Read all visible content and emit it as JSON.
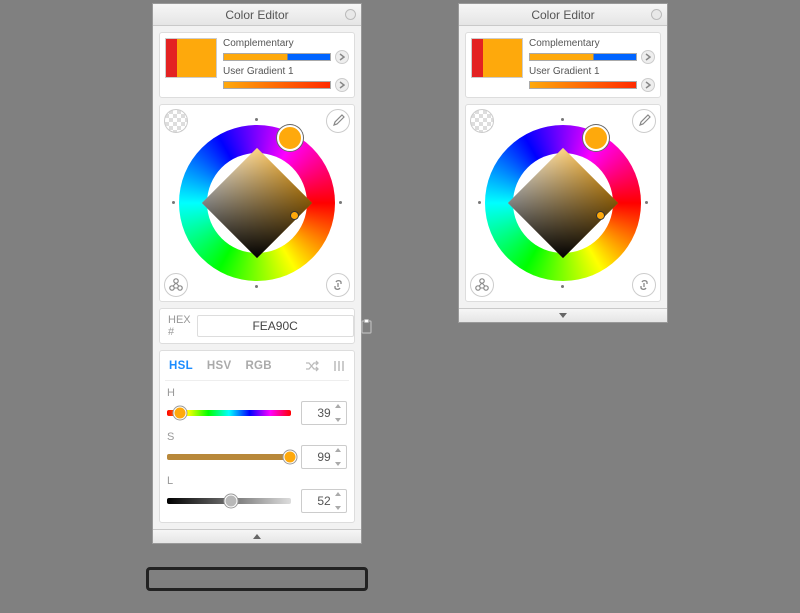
{
  "panel_title": "Color Editor",
  "swatch": {
    "primary_color": "#FEA90C",
    "accent_color": "#E32222",
    "harmony_label": "Complementary",
    "gradient_label": "User Gradient 1"
  },
  "hex": {
    "label": "HEX #",
    "value": "FEA90C"
  },
  "tabs": {
    "hsl": "HSL",
    "hsv": "HSV",
    "rgb": "RGB",
    "active": "HSL"
  },
  "sliders": {
    "h": {
      "label": "H",
      "value": 39,
      "percent": 10.8
    },
    "s": {
      "label": "S",
      "value": 99,
      "percent": 99
    },
    "l": {
      "label": "L",
      "value": 52,
      "percent": 52
    }
  },
  "icons": {
    "transparency": "transparency-icon",
    "eyedropper": "eyedropper-icon",
    "harmony": "harmony-icon",
    "link": "link-icon",
    "clipboard": "clipboard-icon",
    "shuffle": "shuffle-icon",
    "bars": "bars-icon",
    "chevron": "chevron-right-icon",
    "caret_up": "caret-up-icon",
    "caret_down": "caret-down-icon"
  }
}
